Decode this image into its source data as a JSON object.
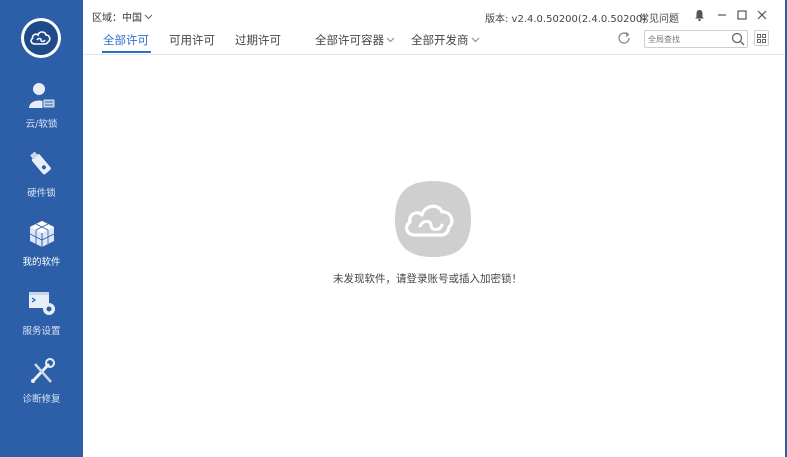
{
  "header": {
    "region_label": "区域：中国",
    "version": "版本: v2.4.0.50200(2.4.0.50200)",
    "faq": "常见问题"
  },
  "sidebar": {
    "items": [
      {
        "label": "云/软锁",
        "icon": "user-cloud-lock-icon"
      },
      {
        "label": "硬件锁",
        "icon": "usb-dongle-icon"
      },
      {
        "label": "我的软件",
        "icon": "software-cube-icon",
        "active": true
      },
      {
        "label": "服务设置",
        "icon": "service-settings-icon"
      },
      {
        "label": "诊断修复",
        "icon": "repair-tools-icon"
      }
    ]
  },
  "tabs": [
    {
      "label": "全部许可",
      "active": true
    },
    {
      "label": "可用许可"
    },
    {
      "label": "过期许可"
    },
    {
      "label": "全部许可容器",
      "dropdown": true
    },
    {
      "label": "全部开发商",
      "dropdown": true
    }
  ],
  "search": {
    "placeholder": "全局查找"
  },
  "empty_state": {
    "message": "未发现软件，请登录账号或插入加密锁！"
  },
  "colors": {
    "sidebar": "#2c5fa8",
    "accent": "#2c6fc9",
    "empty_logo": "#cfcfcf"
  }
}
